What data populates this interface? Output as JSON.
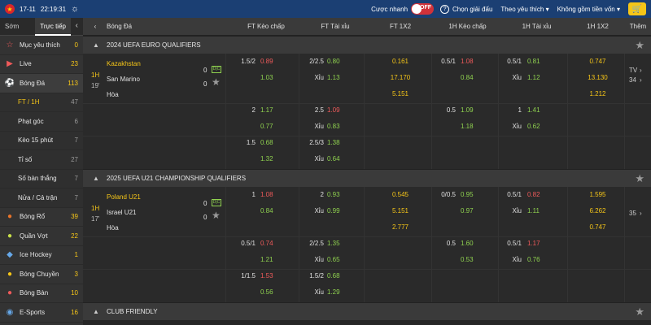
{
  "topbar": {
    "date": "17-11",
    "time": "22:19:31",
    "quick_bet_label": "Cược nhanh",
    "quick_bet_state": "OFF",
    "select_league": "Chọn giải đấu",
    "sort_by": "Theo yêu thích",
    "capital_filter": "Không gồm tiền vốn",
    "accent": "#1b3f73"
  },
  "sidebar": {
    "tabs": [
      "Sớm",
      "Trực tiếp"
    ],
    "items": [
      {
        "label": "Mục yêu thích",
        "count": "0",
        "icon": "star-icon"
      },
      {
        "label": "Live",
        "count": "23",
        "icon": "play-icon"
      },
      {
        "label": "Bóng Đá",
        "count": "113",
        "icon": "soccer-icon"
      },
      {
        "label": "FT / 1H",
        "count": "47",
        "sub": true
      },
      {
        "label": "Phạt góc",
        "count": "6",
        "sub": true
      },
      {
        "label": "Kèo 15 phút",
        "count": "7",
        "sub": true
      },
      {
        "label": "Tỉ số",
        "count": "27",
        "sub": true
      },
      {
        "label": "Số bàn thắng",
        "count": "7",
        "sub": true
      },
      {
        "label": "Nửa / Cả trận",
        "count": "7",
        "sub": true
      },
      {
        "label": "Bóng Rổ",
        "count": "39",
        "icon": "basketball-icon"
      },
      {
        "label": "Quần Vợt",
        "count": "22",
        "icon": "tennis-icon"
      },
      {
        "label": "Ice Hockey",
        "count": "1",
        "icon": "hockey-icon"
      },
      {
        "label": "Bóng Chuyền",
        "count": "3",
        "icon": "volleyball-icon"
      },
      {
        "label": "Bóng Bàn",
        "count": "10",
        "icon": "table-tennis-icon"
      },
      {
        "label": "E-Sports",
        "count": "16",
        "icon": "esports-icon"
      }
    ]
  },
  "columns": {
    "sport": "Bóng Đá",
    "ft_hdp": "FT Kèo chấp",
    "ft_ou": "FT Tài xỉu",
    "ft_1x2": "FT 1X2",
    "h1_hdp": "1H Kèo chấp",
    "h1_ou": "1H Tài xỉu",
    "h1_1x2": "1H 1X2",
    "more": "Thêm"
  },
  "leagues": [
    {
      "name": "2024 UEFA EURO QUALIFIERS",
      "match": {
        "period": "1H",
        "minute": "19'",
        "home": "Kazakhstan",
        "away": "San Marino",
        "draw": "Hòa",
        "home_score": "0",
        "away_score": "0",
        "tv": "TV",
        "more_count": "34",
        "rows": [
          {
            "ft_hdp_line": "1.5/2",
            "ft_hdp_odd": "0.89",
            "ft_ou_line": "2/2.5",
            "ft_ou_odd": "0.80",
            "ft_1x2": "0.161",
            "h1_hdp_line": "0.5/1",
            "h1_hdp_odd": "1.08",
            "h1_ou_line": "0.5/1",
            "h1_ou_odd": "0.81",
            "h1_1x2": "0.747"
          },
          {
            "ft_hdp_line": "",
            "ft_hdp_odd": "1.03",
            "ft_ou_line": "Xỉu",
            "ft_ou_odd": "1.13",
            "ft_1x2": "17.170",
            "h1_hdp_line": "",
            "h1_hdp_odd": "0.84",
            "h1_ou_line": "Xỉu",
            "h1_ou_odd": "1.12",
            "h1_1x2": "13.130"
          },
          {
            "ft_1x2": "5.151",
            "h1_1x2": "1.212"
          },
          {
            "ft_hdp_line": "2",
            "ft_hdp_odd": "1.17",
            "ft_ou_line": "2.5",
            "ft_ou_odd": "1.09",
            "h1_hdp_line": "0.5",
            "h1_hdp_odd": "1.09",
            "h1_ou_line": "1",
            "h1_ou_odd": "1.41"
          },
          {
            "ft_hdp_odd": "0.77",
            "ft_ou_line": "Xỉu",
            "ft_ou_odd": "0.83",
            "h1_hdp_odd": "1.18",
            "h1_ou_line": "Xỉu",
            "h1_ou_odd": "0.62"
          },
          {
            "ft_hdp_line": "1.5",
            "ft_hdp_odd": "0.68",
            "ft_ou_line": "2.5/3",
            "ft_ou_odd": "1.38"
          },
          {
            "ft_hdp_odd": "1.32",
            "ft_ou_line": "Xỉu",
            "ft_ou_odd": "0.64"
          }
        ]
      }
    },
    {
      "name": "2025 UEFA U21 CHAMPIONSHIP QUALIFIERS",
      "match": {
        "period": "1H",
        "minute": "17'",
        "home": "Poland U21",
        "away": "Israel U21",
        "draw": "Hòa",
        "home_score": "0",
        "away_score": "0",
        "more_count": "35",
        "rows": [
          {
            "ft_hdp_line": "1",
            "ft_hdp_odd": "1.08",
            "ft_ou_line": "2",
            "ft_ou_odd": "0.93",
            "ft_1x2": "0.545",
            "h1_hdp_line": "0/0.5",
            "h1_hdp_odd": "0.95",
            "h1_ou_line": "0.5/1",
            "h1_ou_odd": "0.82",
            "h1_1x2": "1.595"
          },
          {
            "ft_hdp_odd": "0.84",
            "ft_ou_line": "Xỉu",
            "ft_ou_odd": "0.99",
            "ft_1x2": "5.151",
            "h1_hdp_odd": "0.97",
            "h1_ou_line": "Xỉu",
            "h1_ou_odd": "1.11",
            "h1_1x2": "6.262"
          },
          {
            "ft_1x2": "2.777",
            "h1_1x2": "0.747"
          },
          {
            "ft_hdp_line": "0.5/1",
            "ft_hdp_odd": "0.74",
            "ft_ou_line": "2/2.5",
            "ft_ou_odd": "1.35",
            "h1_hdp_line": "0.5",
            "h1_hdp_odd": "1.60",
            "h1_ou_line": "0.5/1",
            "h1_ou_odd": "1.17"
          },
          {
            "ft_hdp_odd": "1.21",
            "ft_ou_line": "Xỉu",
            "ft_ou_odd": "0.65",
            "h1_hdp_odd": "0.53",
            "h1_ou_line": "Xỉu",
            "h1_ou_odd": "0.76"
          },
          {
            "ft_hdp_line": "1/1.5",
            "ft_hdp_odd": "1.53",
            "ft_ou_line": "1.5/2",
            "ft_ou_odd": "0.68"
          },
          {
            "ft_hdp_odd": "0.56",
            "ft_ou_line": "Xỉu",
            "ft_ou_odd": "1.29"
          }
        ]
      }
    },
    {
      "name": "CLUB FRIENDLY"
    }
  ]
}
